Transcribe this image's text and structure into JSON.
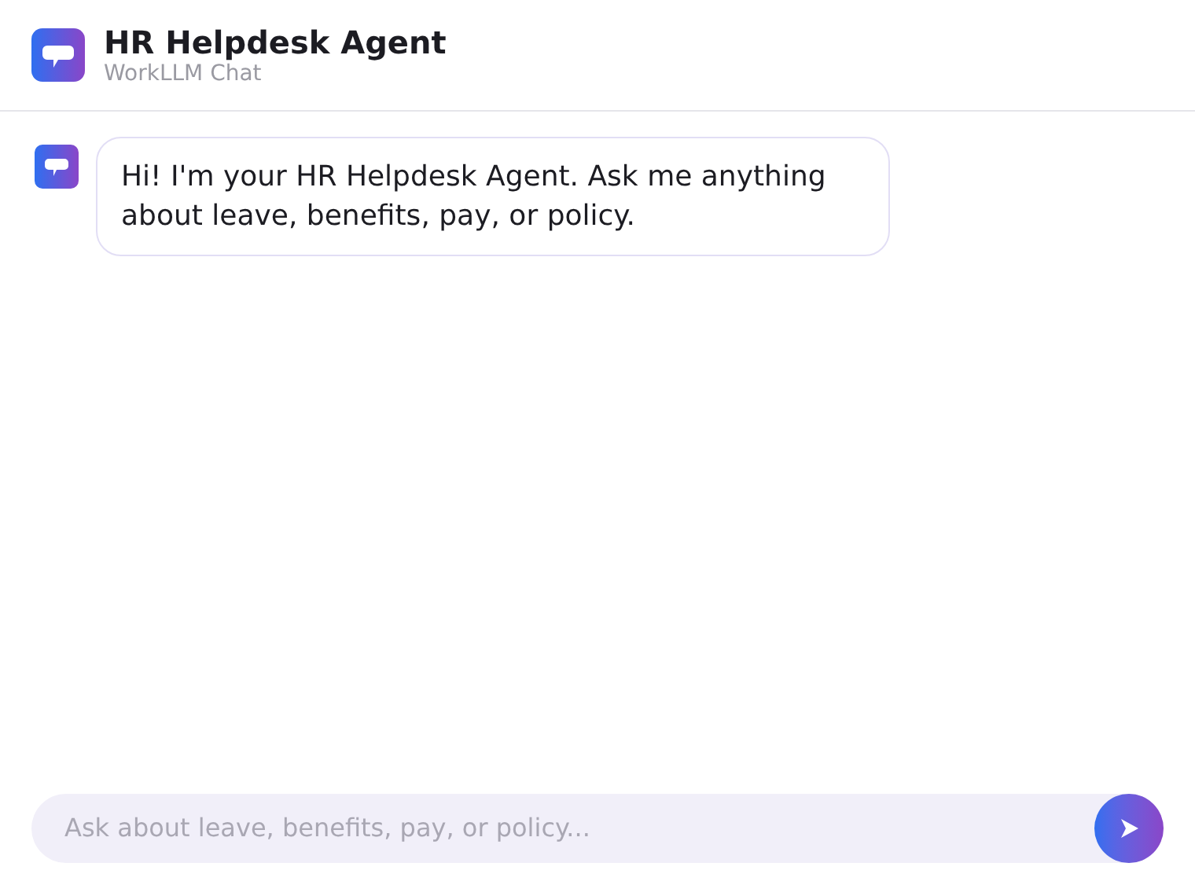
{
  "header": {
    "title": "HR Helpdesk Agent",
    "subtitle": "WorkLLM Chat"
  },
  "messages": [
    {
      "kind": "agent",
      "text": "Hi! I'm your HR Helpdesk Agent. Ask me anything about leave, benefits, pay, or policy."
    }
  ],
  "composer": {
    "placeholder": "Ask about leave, benefits, pay, or policy..."
  }
}
